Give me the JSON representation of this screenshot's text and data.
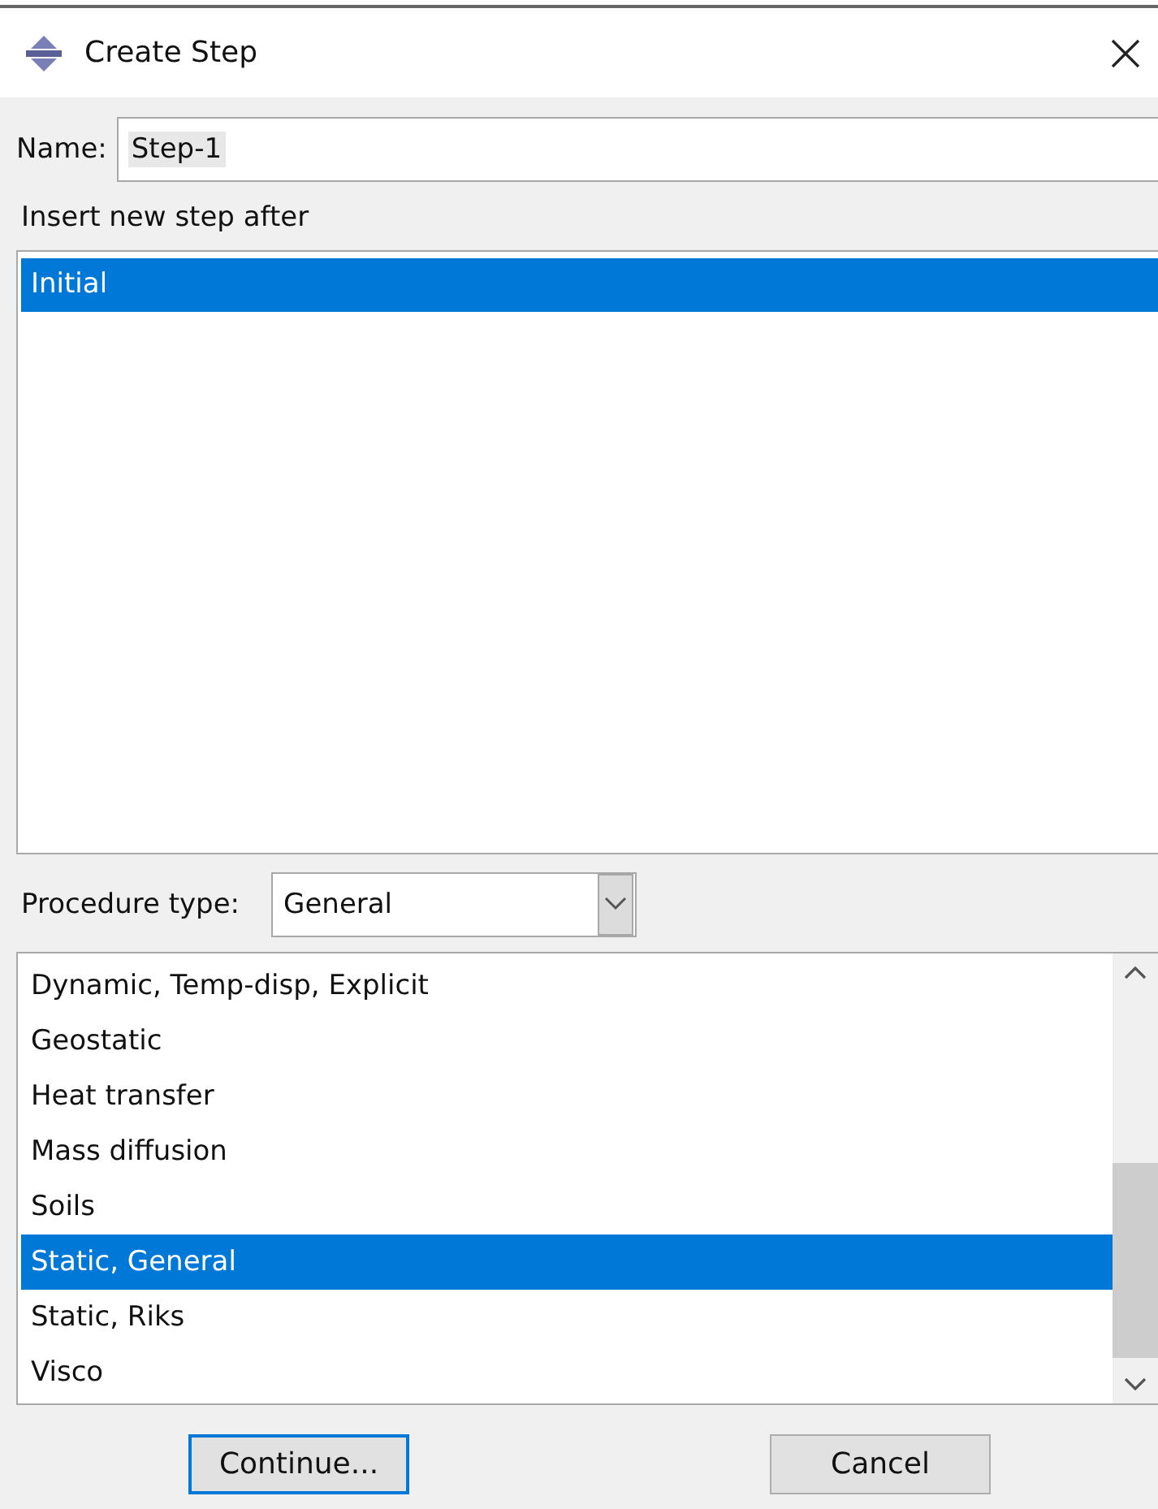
{
  "window": {
    "title": "Create Step"
  },
  "name_field": {
    "label": "Name:",
    "value": "Step-1"
  },
  "insert_after": {
    "label": "Insert new step after",
    "items": [
      {
        "label": "Initial",
        "selected": true
      }
    ]
  },
  "procedure_type": {
    "label": "Procedure type:",
    "value": "General"
  },
  "procedures": [
    {
      "label": "Dynamic, Temp-disp, Explicit",
      "selected": false
    },
    {
      "label": "Geostatic",
      "selected": false
    },
    {
      "label": "Heat transfer",
      "selected": false
    },
    {
      "label": "Mass diffusion",
      "selected": false
    },
    {
      "label": "Soils",
      "selected": false
    },
    {
      "label": "Static, General",
      "selected": true
    },
    {
      "label": "Static, Riks",
      "selected": false
    },
    {
      "label": "Visco",
      "selected": false
    }
  ],
  "buttons": [
    {
      "label": "Continue...",
      "focused": true
    },
    {
      "label": "Cancel",
      "focused": false
    }
  ]
}
